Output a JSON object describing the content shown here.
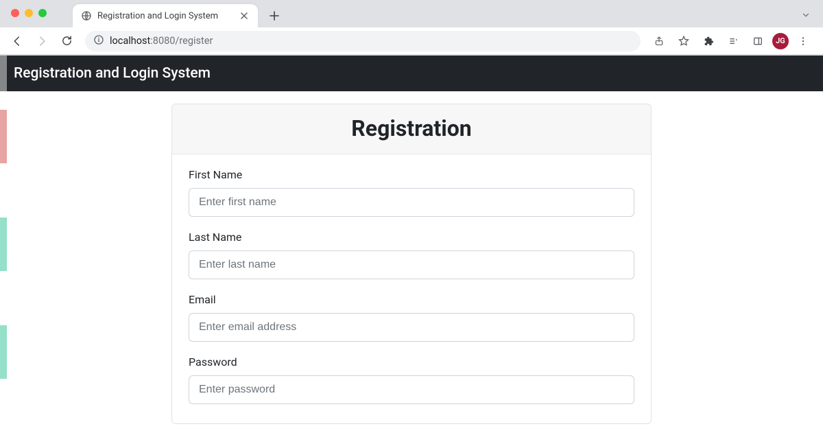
{
  "browser": {
    "tab_title": "Registration and Login System",
    "url_host": "localhost",
    "url_port": ":8080",
    "url_path": "/register",
    "profile_initials": "JG"
  },
  "navbar": {
    "brand": "Registration and Login System"
  },
  "card": {
    "title": "Registration"
  },
  "form": {
    "first_name": {
      "label": "First Name",
      "placeholder": "Enter first name",
      "value": ""
    },
    "last_name": {
      "label": "Last Name",
      "placeholder": "Enter last name",
      "value": ""
    },
    "email": {
      "label": "Email",
      "placeholder": "Enter email address",
      "value": ""
    },
    "password": {
      "label": "Password",
      "placeholder": "Enter password",
      "value": ""
    }
  }
}
